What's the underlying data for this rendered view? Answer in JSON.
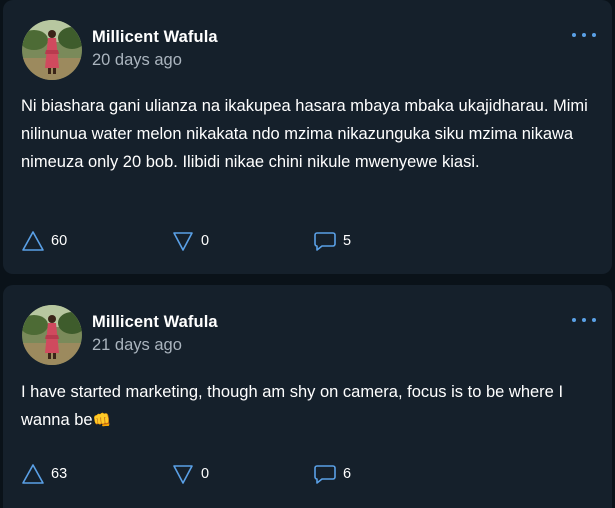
{
  "posts": [
    {
      "author": "Millicent Wafula",
      "time": "20 days ago",
      "text": "Ni biashara gani ulianza na ikakupea hasara mbaya mbaka ukajidharau. Mimi nilinunua water melon nikakata ndo mzima nikazunguka siku mzima nikawa nimeuza only 20 bob. Ilibidi nikae chini nikule mwenyewe kiasi.",
      "upvotes": "60",
      "downvotes": "0",
      "comments": "5"
    },
    {
      "author": "Millicent Wafula",
      "time": "21 days ago",
      "text": "I have started marketing, though am shy on camera, focus is to be where I wanna be",
      "emoji": "👊",
      "upvotes": "63",
      "downvotes": "0",
      "comments": "6"
    }
  ],
  "icons": {
    "upvote": "triangle-up-icon",
    "downvote": "triangle-down-icon",
    "comment": "speech-bubble-icon",
    "more": "three-dots-icon"
  },
  "colors": {
    "card_background": "#15202b",
    "page_background": "#0a1219",
    "accent": "#5aa0e6",
    "secondary_text": "#aab4be"
  }
}
